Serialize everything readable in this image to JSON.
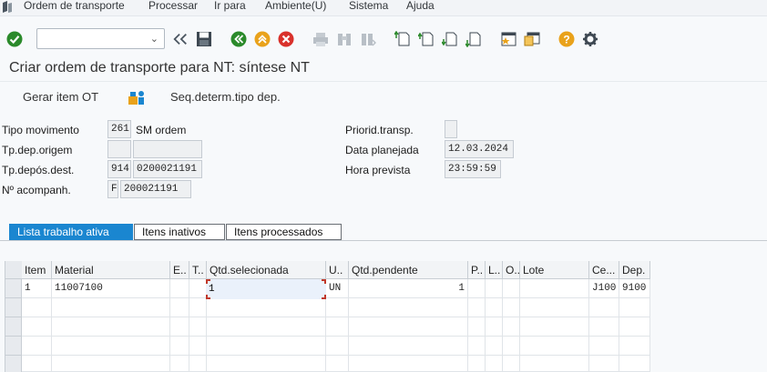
{
  "menu": {
    "items": [
      "Ordem de transporte",
      "Processar",
      "Ir para",
      "Ambiente(U)",
      "Sistema",
      "Ajuda"
    ]
  },
  "toolbar": {
    "command_value": "",
    "icons": [
      "check-icon",
      "history-back-icon",
      "save-icon",
      "back-icon",
      "exit-icon",
      "cancel-icon",
      "print-icon",
      "find-icon",
      "find-next-icon",
      "first-page-icon",
      "previous-page-icon",
      "next-page-icon",
      "last-page-icon",
      "bookmark-icon",
      "new-session-icon",
      "help-icon",
      "settings-icon"
    ]
  },
  "page": {
    "title": "Criar ordem de transporte para NT: síntese NT"
  },
  "appbar": {
    "gerar_label": "Gerar item OT",
    "seq_label": "Seq.determ.tipo dep."
  },
  "header": {
    "tipo_movimento_label": "Tipo movimento",
    "tipo_movimento_value": "261",
    "tipo_movimento_desc": "SM ordem",
    "tp_dep_origem_label": "Tp.dep.origem",
    "tp_dep_origem_value": "",
    "tp_dep_origem_desc": "",
    "tp_depos_dest_label": "Tp.depós.dest.",
    "tp_depos_dest_value": "914",
    "tp_depos_dest_desc": "0200021191",
    "n_acompanh_label": "Nº acompanh.",
    "n_acompanh_value": "F",
    "n_acompanh_desc": "200021191",
    "priorid_label": "Priorid.transp.",
    "priorid_value": "",
    "data_label": "Data planejada",
    "data_value": "12.03.2024",
    "hora_label": "Hora prevista",
    "hora_value": "23:59:59"
  },
  "tabs": [
    "Lista trabalho ativa",
    "Itens inativos",
    "Itens processados"
  ],
  "table": {
    "columns": [
      "Item",
      "Material",
      "E..",
      "T..",
      "Qtd.selecionada",
      "U..",
      "Qtd.pendente",
      "P..",
      "L..",
      "O..",
      "Lote",
      "Ce...",
      "Dep."
    ],
    "rows": [
      {
        "item": "1",
        "material": "11007100",
        "e": "",
        "t": "",
        "qtd_sel": "1",
        "u": "UN",
        "qtd_pend": "1",
        "p": "",
        "l": "",
        "o": "",
        "lote": "",
        "ce": "J100",
        "dep": "9100"
      }
    ]
  }
}
